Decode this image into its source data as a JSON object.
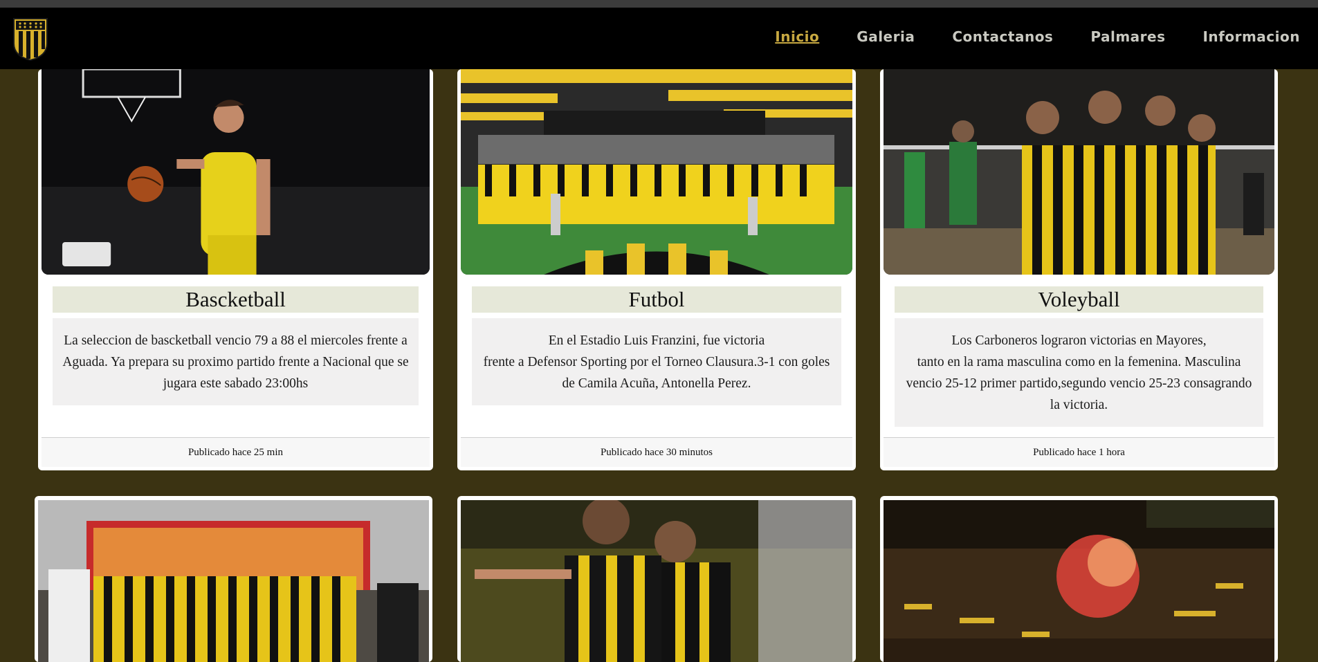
{
  "nav": {
    "links": [
      "Inicio",
      "Galeria",
      "Contactanos",
      "Palmares",
      "Informacion"
    ],
    "active_index": 0
  },
  "colors": {
    "background": "#3b3312",
    "navbar": "#000000",
    "accent_gold": "#c8a941",
    "title_bg": "#e6e8d9",
    "desc_bg": "#f1f0f0"
  },
  "cards": [
    {
      "title": "Bascketball",
      "description": "La seleccion de bascketball vencio 79 a 88 el miercoles frente a Aguada. Ya prepara su proximo partido frente a Nacional que se jugara este sabado 23:00hs",
      "footer": "Publicado hace 25 min"
    },
    {
      "title": "Futbol",
      "description_lines": [
        "En el Estadio Luis Franzini, fue victoria",
        "frente a Defensor Sporting por el Torneo Clausura.3-1 con goles de Camila Acuña, Antonella Perez."
      ],
      "footer": "Publicado hace 30 minutos"
    },
    {
      "title": "Voleyball",
      "description_lines": [
        "Los Carboneros lograron victorias en Mayores,",
        "tanto en la rama masculina como en la femenina. Masculina vencio 25-12 primer partido,segundo vencio 25-23 consagrando la victoria."
      ],
      "footer": "Publicado hace 1 hora"
    }
  ]
}
